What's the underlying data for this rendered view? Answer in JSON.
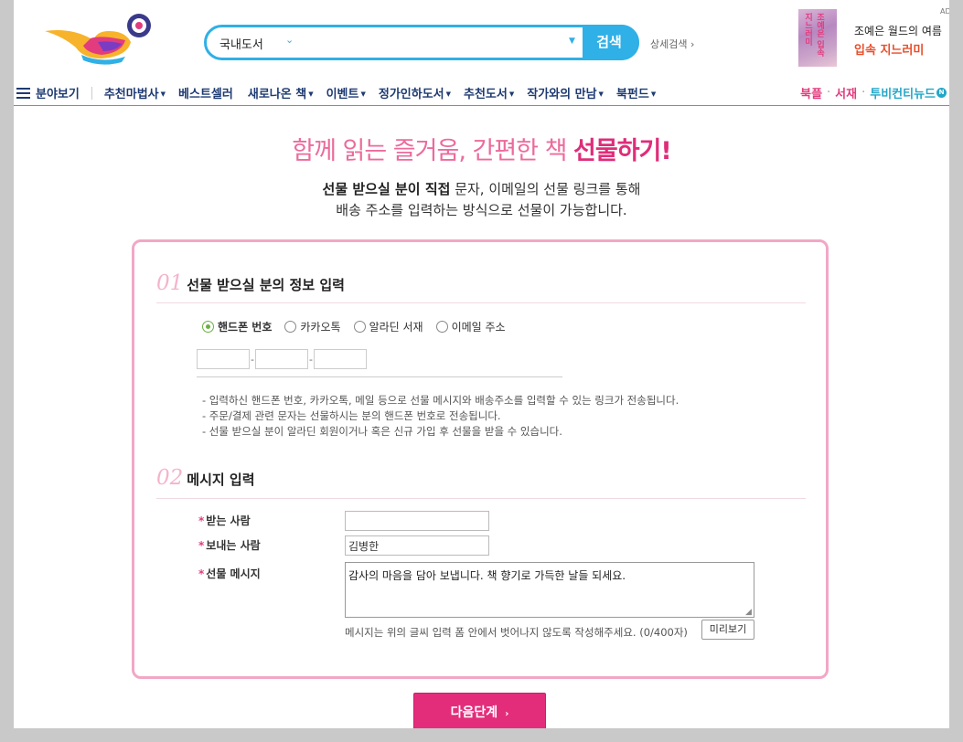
{
  "header": {
    "search": {
      "category": "국내도서",
      "button": "검색"
    },
    "advanced_search": "상세검색 ›",
    "ad": {
      "mark": "AD",
      "line1": "조예은 월드의 여름",
      "line2": "입속 지느러미",
      "book_text": "조예은 입속 지느러미"
    }
  },
  "gnb": {
    "menu": "분야보기",
    "items": [
      {
        "label": "추천마법사",
        "arrow": "▼"
      },
      {
        "label": "베스트셀러",
        "arrow": ""
      },
      {
        "label": "새로나온 책",
        "arrow": "▼"
      },
      {
        "label": "이벤트",
        "arrow": "▼"
      },
      {
        "label": "정가인하도서",
        "arrow": "▼"
      },
      {
        "label": "추천도서",
        "arrow": "▼"
      },
      {
        "label": "작가와의 만남",
        "arrow": "▼"
      },
      {
        "label": "북펀드",
        "arrow": "▼"
      }
    ],
    "right": {
      "bookple": "북플",
      "library": "서재",
      "tv": "투비컨티뉴드",
      "new_badge": "N"
    }
  },
  "intro": {
    "title_plain": "함께 읽는 즐거움, 간편한 책 ",
    "title_bold": "선물하기!",
    "sub1_bold": "선물 받으실 분이 직접",
    "sub1_rest": " 문자, 이메일의 선물 링크를 통해",
    "sub2": "배송 주소를 입력하는 방식으로 선물이 가능합니다."
  },
  "section1": {
    "num": "01",
    "title": "선물 받으실 분의 정보 입력",
    "options": [
      {
        "label": "핸드폰 번호",
        "selected": true
      },
      {
        "label": "카카오톡",
        "selected": false
      },
      {
        "label": "알라딘 서재",
        "selected": false
      },
      {
        "label": "이메일 주소",
        "selected": false
      }
    ],
    "phone_sep": "-",
    "notes": [
      "- 입력하신 핸드폰 번호, 카카오톡, 메일 등으로 선물 메시지와 배송주소를 입력할 수 있는 링크가 전송됩니다.",
      "- 주문/결제 관련 문자는 선물하시는 분의 핸드폰 번호로 전송됩니다.",
      "- 선물 받으실 분이 알라딘 회원이거나 혹은 신규 가입 후 선물을 받을 수 있습니다."
    ]
  },
  "section2": {
    "num": "02",
    "title": "메시지 입력",
    "required_mark": "*",
    "recipient_label": "받는 사람",
    "recipient_value": "",
    "sender_label": "보내는 사람",
    "sender_value": "김병한",
    "message_label": "선물 메시지",
    "message_value": "감사의 마음을 담아 보냅니다. 책 향기로 가득한 날들 되세요.",
    "count_note": "메시지는 위의 글씨 입력 폼 안에서 벗어나지 않도록 작성해주세요. (0/400자)",
    "preview_button": "미리보기"
  },
  "next_button": "다음단계",
  "colors": {
    "brand_pink": "#e32d7b",
    "brand_blue": "#2fb0e6",
    "nav_navy": "#1d3a72",
    "box_border": "#f2a7c5"
  }
}
